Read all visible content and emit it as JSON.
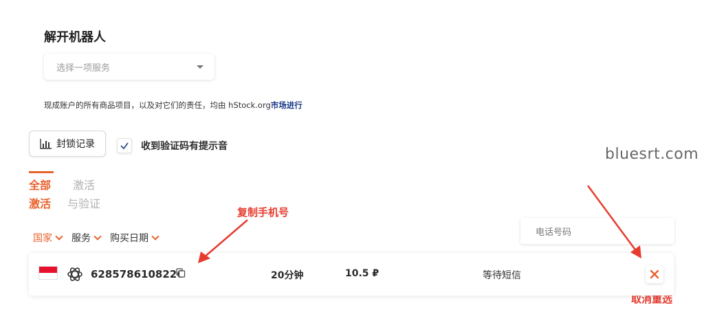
{
  "unlock": {
    "title": "解开机器人",
    "service_placeholder": "选择一项服务"
  },
  "notice": {
    "text": "现成账户的所有商品项目，以及对它们的责任，均由 hStock.org",
    "link": "市场进行"
  },
  "block_button": {
    "label": "封锁记录",
    "icon": "bar-chart-icon"
  },
  "sound_option": {
    "label": "收到验证码有提示音",
    "checked": true
  },
  "watermark": "bluesrt.com",
  "tabs": [
    {
      "line1": "全部",
      "line2": "激活",
      "active": true
    },
    {
      "line1": "激活",
      "line2": "与验证",
      "active": false
    }
  ],
  "filters": [
    {
      "label": "国家",
      "active": true
    },
    {
      "label": "服务",
      "active": false
    },
    {
      "label": "购买日期",
      "active": false
    }
  ],
  "phone_search": {
    "placeholder": "电话号码"
  },
  "annotations": {
    "copy": "复制手机号",
    "cancel": "取消重选"
  },
  "order": {
    "country_flag": "indonesia-flag",
    "service_icon": "openai-icon",
    "phone": "6285786108226",
    "duration": "20分钟",
    "price": "10.5 ₽",
    "status": "等待短信"
  },
  "colors": {
    "accent": "#e8612c",
    "annotation": "#e63b2e",
    "link": "#1b3a8c"
  }
}
